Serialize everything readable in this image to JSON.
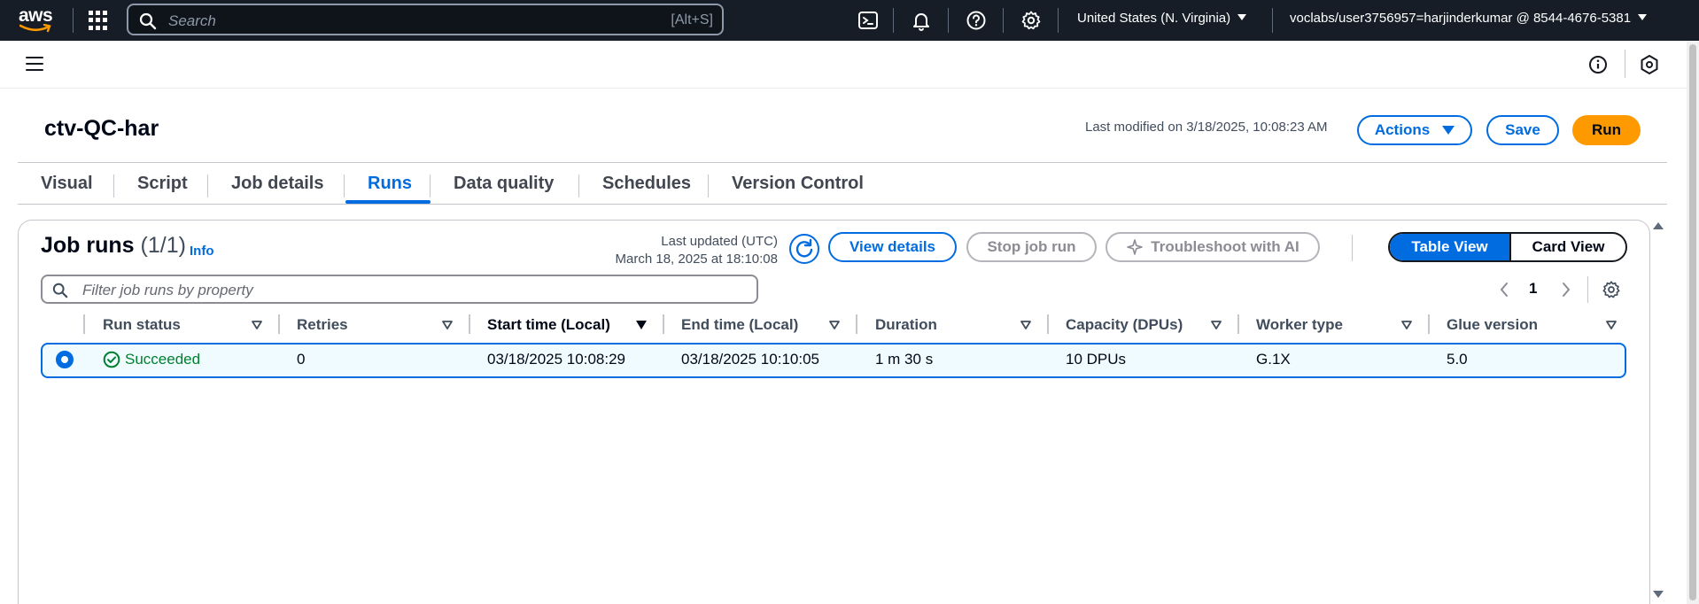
{
  "nav": {
    "logo": "aws",
    "search_placeholder": "Search",
    "search_shortcut": "[Alt+S]",
    "icons": [
      "cloudshell-icon",
      "bell-icon",
      "help-icon",
      "settings-icon"
    ],
    "region": "United States (N. Virginia)",
    "account": "voclabs/user3756957=harjinderkumar @ 8544-4676-5381"
  },
  "header": {
    "job_name": "ctv-QC-har",
    "last_modified": "Last modified on 3/18/2025, 10:08:23 AM",
    "actions_label": "Actions",
    "save_label": "Save",
    "run_label": "Run"
  },
  "tabs": [
    {
      "label": "Visual"
    },
    {
      "label": "Script"
    },
    {
      "label": "Job details"
    },
    {
      "label": "Runs",
      "active": true
    },
    {
      "label": "Data quality"
    },
    {
      "label": "Schedules"
    },
    {
      "label": "Version Control"
    }
  ],
  "runs": {
    "title": "Job runs",
    "count": "(1/1)",
    "info_label": "Info",
    "last_updated_label": "Last updated (UTC)",
    "last_updated_value": "March 18, 2025 at 18:10:08",
    "view_details_label": "View details",
    "stop_label": "Stop job run",
    "troubleshoot_label": "Troubleshoot with AI",
    "table_view_label": "Table View",
    "card_view_label": "Card View",
    "filter_placeholder": "Filter job runs by property",
    "page": "1",
    "columns": [
      "Run status",
      "Retries",
      "Start time (Local)",
      "End time (Local)",
      "Duration",
      "Capacity (DPUs)",
      "Worker type",
      "Glue version"
    ],
    "rows": [
      {
        "status": "Succeeded",
        "retries": "0",
        "start_time": "03/18/2025 10:08:29",
        "end_time": "03/18/2025 10:10:05",
        "duration": "1 m 30 s",
        "capacity": "10 DPUs",
        "worker_type": "G.1X",
        "glue_version": "5.0"
      }
    ]
  },
  "colors": {
    "nav_bg": "#161d26",
    "accent": "#006ce0",
    "primary_button": "#ff9900",
    "success": "#00802f"
  }
}
